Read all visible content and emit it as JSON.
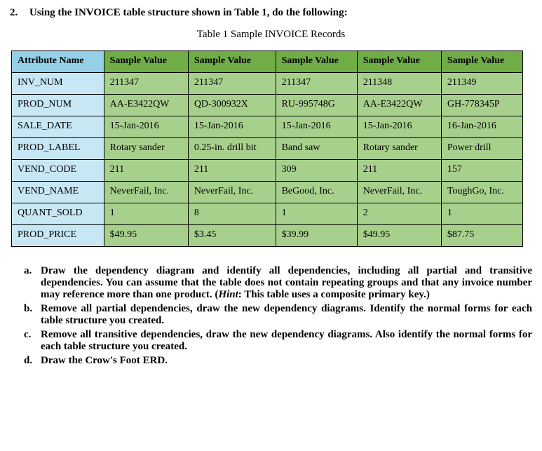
{
  "heading": {
    "number": "2.",
    "text": "Using the INVOICE table structure shown in Table 1, do the following:"
  },
  "caption": "Table 1 Sample INVOICE Records",
  "table": {
    "headers": [
      "Attribute Name",
      "Sample Value",
      "Sample Value",
      "Sample Value",
      "Sample Value",
      "Sample Value"
    ],
    "rows": [
      [
        "INV_NUM",
        "211347",
        "211347",
        "211347",
        "211348",
        "211349"
      ],
      [
        "PROD_NUM",
        "AA-E3422QW",
        "QD-300932X",
        "RU-995748G",
        "AA-E3422QW",
        "GH-778345P"
      ],
      [
        "SALE_DATE",
        "15-Jan-2016",
        "15-Jan-2016",
        "15-Jan-2016",
        "15-Jan-2016",
        "16-Jan-2016"
      ],
      [
        "PROD_LABEL",
        "Rotary sander",
        "0.25-in. drill bit",
        "Band saw",
        "Rotary sander",
        "Power drill"
      ],
      [
        "VEND_CODE",
        "211",
        "211",
        "309",
        "211",
        "157"
      ],
      [
        "VEND_NAME",
        "NeverFail, Inc.",
        "NeverFail, Inc.",
        "BeGood, Inc.",
        "NeverFail, Inc.",
        "ToughGo, Inc."
      ],
      [
        "QUANT_SOLD",
        "1",
        "8",
        "1",
        "2",
        "1"
      ],
      [
        "PROD_PRICE",
        "$49.95",
        "$3.45",
        "$39.99",
        "$49.95",
        "$87.75"
      ]
    ]
  },
  "questions": {
    "a": {
      "letter": "a.",
      "pre": "Draw the dependency diagram and identify all dependencies, including all partial and transitive dependencies. You can assume that the table does not contain repeating groups and that any invoice number may reference more than one product. (",
      "hint_label": "Hint",
      "post": ": This table uses a composite primary key.)"
    },
    "b": {
      "letter": "b.",
      "text": "Remove all partial dependencies, draw the new dependency diagrams. Identify the normal forms for each table structure you created."
    },
    "c": {
      "letter": "c.",
      "text": "Remove all transitive dependencies, draw the new dependency diagrams. Also identify the normal forms for each table structure you created."
    },
    "d": {
      "letter": "d.",
      "text": "Draw the Crow's Foot ERD."
    }
  }
}
